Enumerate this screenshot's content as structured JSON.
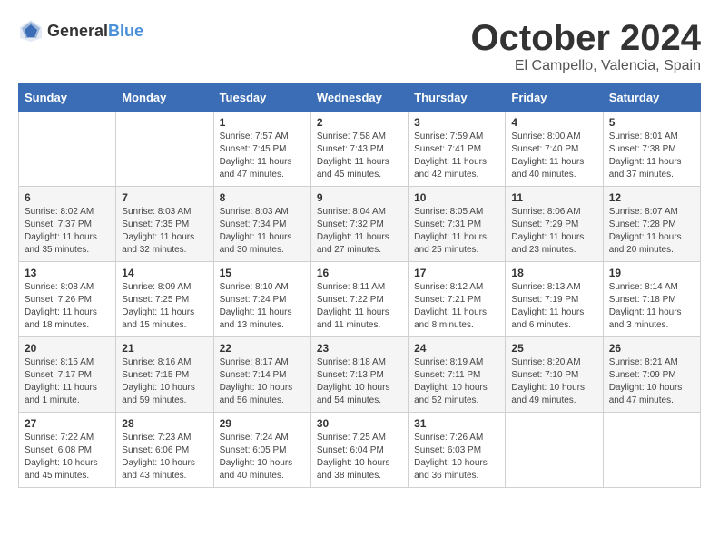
{
  "logo": {
    "text_general": "General",
    "text_blue": "Blue"
  },
  "title": {
    "month": "October 2024",
    "location": "El Campello, Valencia, Spain"
  },
  "headers": [
    "Sunday",
    "Monday",
    "Tuesday",
    "Wednesday",
    "Thursday",
    "Friday",
    "Saturday"
  ],
  "weeks": [
    [
      {
        "day": "",
        "content": ""
      },
      {
        "day": "",
        "content": ""
      },
      {
        "day": "1",
        "content": "Sunrise: 7:57 AM\nSunset: 7:45 PM\nDaylight: 11 hours and 47 minutes."
      },
      {
        "day": "2",
        "content": "Sunrise: 7:58 AM\nSunset: 7:43 PM\nDaylight: 11 hours and 45 minutes."
      },
      {
        "day": "3",
        "content": "Sunrise: 7:59 AM\nSunset: 7:41 PM\nDaylight: 11 hours and 42 minutes."
      },
      {
        "day": "4",
        "content": "Sunrise: 8:00 AM\nSunset: 7:40 PM\nDaylight: 11 hours and 40 minutes."
      },
      {
        "day": "5",
        "content": "Sunrise: 8:01 AM\nSunset: 7:38 PM\nDaylight: 11 hours and 37 minutes."
      }
    ],
    [
      {
        "day": "6",
        "content": "Sunrise: 8:02 AM\nSunset: 7:37 PM\nDaylight: 11 hours and 35 minutes."
      },
      {
        "day": "7",
        "content": "Sunrise: 8:03 AM\nSunset: 7:35 PM\nDaylight: 11 hours and 32 minutes."
      },
      {
        "day": "8",
        "content": "Sunrise: 8:03 AM\nSunset: 7:34 PM\nDaylight: 11 hours and 30 minutes."
      },
      {
        "day": "9",
        "content": "Sunrise: 8:04 AM\nSunset: 7:32 PM\nDaylight: 11 hours and 27 minutes."
      },
      {
        "day": "10",
        "content": "Sunrise: 8:05 AM\nSunset: 7:31 PM\nDaylight: 11 hours and 25 minutes."
      },
      {
        "day": "11",
        "content": "Sunrise: 8:06 AM\nSunset: 7:29 PM\nDaylight: 11 hours and 23 minutes."
      },
      {
        "day": "12",
        "content": "Sunrise: 8:07 AM\nSunset: 7:28 PM\nDaylight: 11 hours and 20 minutes."
      }
    ],
    [
      {
        "day": "13",
        "content": "Sunrise: 8:08 AM\nSunset: 7:26 PM\nDaylight: 11 hours and 18 minutes."
      },
      {
        "day": "14",
        "content": "Sunrise: 8:09 AM\nSunset: 7:25 PM\nDaylight: 11 hours and 15 minutes."
      },
      {
        "day": "15",
        "content": "Sunrise: 8:10 AM\nSunset: 7:24 PM\nDaylight: 11 hours and 13 minutes."
      },
      {
        "day": "16",
        "content": "Sunrise: 8:11 AM\nSunset: 7:22 PM\nDaylight: 11 hours and 11 minutes."
      },
      {
        "day": "17",
        "content": "Sunrise: 8:12 AM\nSunset: 7:21 PM\nDaylight: 11 hours and 8 minutes."
      },
      {
        "day": "18",
        "content": "Sunrise: 8:13 AM\nSunset: 7:19 PM\nDaylight: 11 hours and 6 minutes."
      },
      {
        "day": "19",
        "content": "Sunrise: 8:14 AM\nSunset: 7:18 PM\nDaylight: 11 hours and 3 minutes."
      }
    ],
    [
      {
        "day": "20",
        "content": "Sunrise: 8:15 AM\nSunset: 7:17 PM\nDaylight: 11 hours and 1 minute."
      },
      {
        "day": "21",
        "content": "Sunrise: 8:16 AM\nSunset: 7:15 PM\nDaylight: 10 hours and 59 minutes."
      },
      {
        "day": "22",
        "content": "Sunrise: 8:17 AM\nSunset: 7:14 PM\nDaylight: 10 hours and 56 minutes."
      },
      {
        "day": "23",
        "content": "Sunrise: 8:18 AM\nSunset: 7:13 PM\nDaylight: 10 hours and 54 minutes."
      },
      {
        "day": "24",
        "content": "Sunrise: 8:19 AM\nSunset: 7:11 PM\nDaylight: 10 hours and 52 minutes."
      },
      {
        "day": "25",
        "content": "Sunrise: 8:20 AM\nSunset: 7:10 PM\nDaylight: 10 hours and 49 minutes."
      },
      {
        "day": "26",
        "content": "Sunrise: 8:21 AM\nSunset: 7:09 PM\nDaylight: 10 hours and 47 minutes."
      }
    ],
    [
      {
        "day": "27",
        "content": "Sunrise: 7:22 AM\nSunset: 6:08 PM\nDaylight: 10 hours and 45 minutes."
      },
      {
        "day": "28",
        "content": "Sunrise: 7:23 AM\nSunset: 6:06 PM\nDaylight: 10 hours and 43 minutes."
      },
      {
        "day": "29",
        "content": "Sunrise: 7:24 AM\nSunset: 6:05 PM\nDaylight: 10 hours and 40 minutes."
      },
      {
        "day": "30",
        "content": "Sunrise: 7:25 AM\nSunset: 6:04 PM\nDaylight: 10 hours and 38 minutes."
      },
      {
        "day": "31",
        "content": "Sunrise: 7:26 AM\nSunset: 6:03 PM\nDaylight: 10 hours and 36 minutes."
      },
      {
        "day": "",
        "content": ""
      },
      {
        "day": "",
        "content": ""
      }
    ]
  ]
}
